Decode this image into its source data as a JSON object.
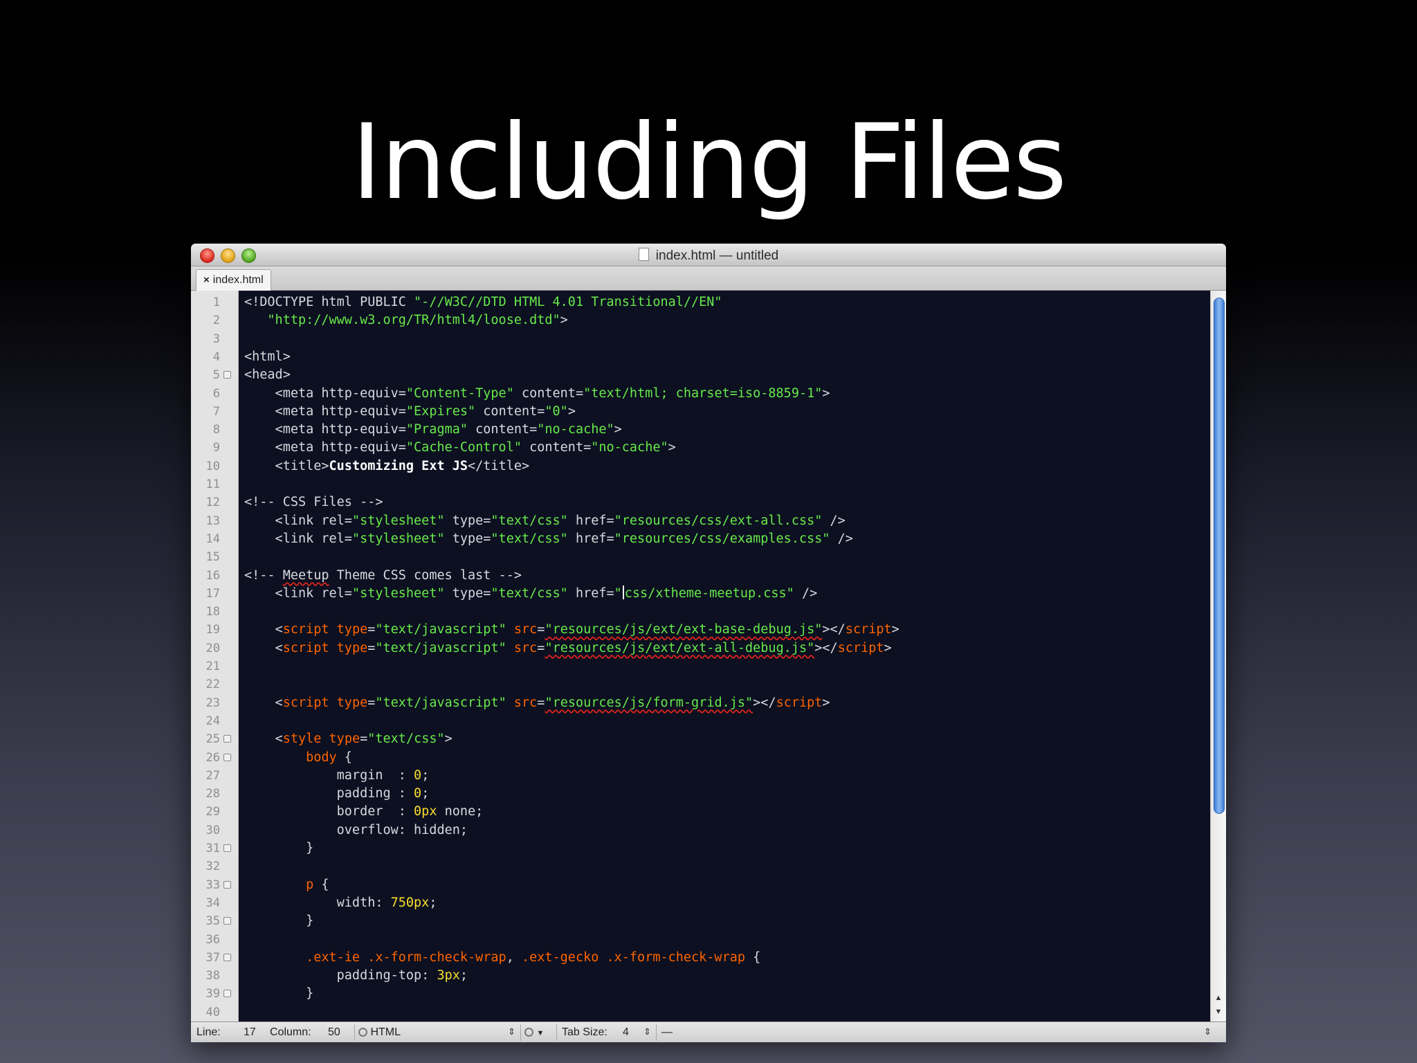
{
  "slide": {
    "title": "Including Files"
  },
  "window": {
    "title": "index.html — untitled"
  },
  "tabs": [
    {
      "label": "index.html",
      "close": "×"
    }
  ],
  "editor": {
    "lines": [
      {
        "n": "1",
        "fold": false,
        "segs": [
          [
            "t",
            "<!DOCTYPE html PUBLIC "
          ],
          [
            "s",
            "\"-//W3C//DTD HTML 4.01 Transitional//EN\""
          ]
        ]
      },
      {
        "n": "2",
        "fold": false,
        "segs": [
          [
            "s",
            "   \"http://www.w3.org/TR/html4/loose.dtd\""
          ],
          [
            "t",
            ">"
          ]
        ]
      },
      {
        "n": "3",
        "fold": false,
        "segs": []
      },
      {
        "n": "4",
        "fold": false,
        "segs": [
          [
            "t",
            "<html>"
          ]
        ]
      },
      {
        "n": "5",
        "fold": true,
        "segs": [
          [
            "t",
            "<head>"
          ]
        ]
      },
      {
        "n": "6",
        "fold": false,
        "segs": [
          [
            "t",
            "    <meta http-equiv="
          ],
          [
            "s",
            "\"Content-Type\""
          ],
          [
            "t",
            " content="
          ],
          [
            "s",
            "\"text/html; charset=iso-8859-1\""
          ],
          [
            "t",
            ">"
          ]
        ]
      },
      {
        "n": "7",
        "fold": false,
        "segs": [
          [
            "t",
            "    <meta http-equiv="
          ],
          [
            "s",
            "\"Expires\""
          ],
          [
            "t",
            " content="
          ],
          [
            "s",
            "\"0\""
          ],
          [
            "t",
            ">"
          ]
        ]
      },
      {
        "n": "8",
        "fold": false,
        "segs": [
          [
            "t",
            "    <meta http-equiv="
          ],
          [
            "s",
            "\"Pragma\""
          ],
          [
            "t",
            " content="
          ],
          [
            "s",
            "\"no-cache\""
          ],
          [
            "t",
            ">"
          ]
        ]
      },
      {
        "n": "9",
        "fold": false,
        "segs": [
          [
            "t",
            "    <meta http-equiv="
          ],
          [
            "s",
            "\"Cache-Control\""
          ],
          [
            "t",
            " content="
          ],
          [
            "s",
            "\"no-cache\""
          ],
          [
            "t",
            ">"
          ]
        ]
      },
      {
        "n": "10",
        "fold": false,
        "segs": [
          [
            "t",
            "    <title>"
          ],
          [
            "w",
            "Customizing Ext JS"
          ],
          [
            "t",
            "</title>"
          ]
        ]
      },
      {
        "n": "11",
        "fold": false,
        "segs": []
      },
      {
        "n": "12",
        "fold": false,
        "segs": [
          [
            "c",
            "<!-- CSS Files -->"
          ]
        ]
      },
      {
        "n": "13",
        "fold": false,
        "segs": [
          [
            "t",
            "    <link rel="
          ],
          [
            "s",
            "\"stylesheet\""
          ],
          [
            "t",
            " type="
          ],
          [
            "s",
            "\"text/css\""
          ],
          [
            "t",
            " href="
          ],
          [
            "s",
            "\"resources/css/ext-all.css\""
          ],
          [
            "t",
            " />"
          ]
        ]
      },
      {
        "n": "14",
        "fold": false,
        "segs": [
          [
            "t",
            "    <link rel="
          ],
          [
            "s",
            "\"stylesheet\""
          ],
          [
            "t",
            " type="
          ],
          [
            "s",
            "\"text/css\""
          ],
          [
            "t",
            " href="
          ],
          [
            "s",
            "\"resources/css/examples.css\""
          ],
          [
            "t",
            " />"
          ]
        ]
      },
      {
        "n": "15",
        "fold": false,
        "segs": []
      },
      {
        "n": "16",
        "fold": false,
        "segs": [
          [
            "c",
            "<!-- "
          ],
          [
            "csp",
            "Meetup"
          ],
          [
            "c",
            " Theme CSS comes last -->"
          ]
        ]
      },
      {
        "n": "17",
        "fold": false,
        "segs": [
          [
            "t",
            "    <link rel="
          ],
          [
            "s",
            "\"stylesheet\""
          ],
          [
            "t",
            " type="
          ],
          [
            "s",
            "\"text/css\""
          ],
          [
            "t",
            " href="
          ],
          [
            "s",
            "\""
          ],
          [
            "cursor",
            ""
          ],
          [
            "s",
            "css/xtheme-meetup.css\""
          ],
          [
            "t",
            " />"
          ]
        ]
      },
      {
        "n": "18",
        "fold": false,
        "segs": []
      },
      {
        "n": "19",
        "fold": false,
        "segs": [
          [
            "t",
            "    <"
          ],
          [
            "o",
            "script"
          ],
          [
            "o",
            " type"
          ],
          [
            "t",
            "="
          ],
          [
            "s",
            "\"text/javascript\""
          ],
          [
            "o",
            " src"
          ],
          [
            "t",
            "="
          ],
          [
            "ssp",
            "\"resources/js/ext/ext-base-debug.js\""
          ],
          [
            "t",
            "></"
          ],
          [
            "o",
            "script"
          ],
          [
            "t",
            ">"
          ]
        ]
      },
      {
        "n": "20",
        "fold": false,
        "segs": [
          [
            "t",
            "    <"
          ],
          [
            "o",
            "script"
          ],
          [
            "o",
            " type"
          ],
          [
            "t",
            "="
          ],
          [
            "s",
            "\"text/javascript\""
          ],
          [
            "o",
            " src"
          ],
          [
            "t",
            "="
          ],
          [
            "ssp",
            "\"resources/js/ext/ext-all-debug.js\""
          ],
          [
            "t",
            "></"
          ],
          [
            "o",
            "script"
          ],
          [
            "t",
            ">"
          ]
        ]
      },
      {
        "n": "21",
        "fold": false,
        "segs": []
      },
      {
        "n": "22",
        "fold": false,
        "segs": []
      },
      {
        "n": "23",
        "fold": false,
        "segs": [
          [
            "t",
            "    <"
          ],
          [
            "o",
            "script"
          ],
          [
            "o",
            " type"
          ],
          [
            "t",
            "="
          ],
          [
            "s",
            "\"text/javascript\""
          ],
          [
            "o",
            " src"
          ],
          [
            "t",
            "="
          ],
          [
            "ssp",
            "\"resources/js/form-grid.js\""
          ],
          [
            "t",
            "></"
          ],
          [
            "o",
            "script"
          ],
          [
            "t",
            ">"
          ]
        ]
      },
      {
        "n": "24",
        "fold": false,
        "segs": []
      },
      {
        "n": "25",
        "fold": true,
        "segs": [
          [
            "t",
            "    <"
          ],
          [
            "o",
            "style"
          ],
          [
            "o",
            " type"
          ],
          [
            "t",
            "="
          ],
          [
            "s",
            "\"text/css\""
          ],
          [
            "t",
            ">"
          ]
        ]
      },
      {
        "n": "26",
        "fold": true,
        "segs": [
          [
            "o",
            "        body"
          ],
          [
            "t",
            " {"
          ]
        ]
      },
      {
        "n": "27",
        "fold": false,
        "segs": [
          [
            "t",
            "            margin  : "
          ],
          [
            "n",
            "0"
          ],
          [
            "t",
            ";"
          ]
        ]
      },
      {
        "n": "28",
        "fold": false,
        "segs": [
          [
            "t",
            "            padding : "
          ],
          [
            "n",
            "0"
          ],
          [
            "t",
            ";"
          ]
        ]
      },
      {
        "n": "29",
        "fold": false,
        "segs": [
          [
            "t",
            "            border  : "
          ],
          [
            "n",
            "0px"
          ],
          [
            "t",
            " none;"
          ]
        ]
      },
      {
        "n": "30",
        "fold": false,
        "segs": [
          [
            "t",
            "            overflow: hidden;"
          ]
        ]
      },
      {
        "n": "31",
        "fold": true,
        "segs": [
          [
            "t",
            "        }"
          ]
        ]
      },
      {
        "n": "32",
        "fold": false,
        "segs": []
      },
      {
        "n": "33",
        "fold": true,
        "segs": [
          [
            "o",
            "        p"
          ],
          [
            "t",
            " {"
          ]
        ]
      },
      {
        "n": "34",
        "fold": false,
        "segs": [
          [
            "t",
            "            width: "
          ],
          [
            "n",
            "750px"
          ],
          [
            "t",
            ";"
          ]
        ]
      },
      {
        "n": "35",
        "fold": true,
        "segs": [
          [
            "t",
            "        }"
          ]
        ]
      },
      {
        "n": "36",
        "fold": false,
        "segs": []
      },
      {
        "n": "37",
        "fold": true,
        "segs": [
          [
            "o",
            "        .ext-ie .x-form-check-wrap"
          ],
          [
            "t",
            ", "
          ],
          [
            "o",
            ".ext-gecko .x-form-check-wrap"
          ],
          [
            "t",
            " {"
          ]
        ]
      },
      {
        "n": "38",
        "fold": false,
        "segs": [
          [
            "t",
            "            padding-top: "
          ],
          [
            "n",
            "3px"
          ],
          [
            "t",
            ";"
          ]
        ]
      },
      {
        "n": "39",
        "fold": true,
        "segs": [
          [
            "t",
            "        }"
          ]
        ]
      },
      {
        "n": "40",
        "fold": false,
        "segs": []
      }
    ]
  },
  "statusbar": {
    "line_label": "Line:",
    "line_value": "17",
    "column_label": "Column:",
    "column_value": "50",
    "language": "HTML",
    "tab_size_label": "Tab Size:",
    "tab_size_value": "4",
    "symbol": "—"
  },
  "colors": {
    "editor_background": "#0c1021",
    "string": "#68ea4a",
    "keyword": "#ff6400",
    "number": "#fbde2d",
    "plain": "#d8dadf"
  }
}
